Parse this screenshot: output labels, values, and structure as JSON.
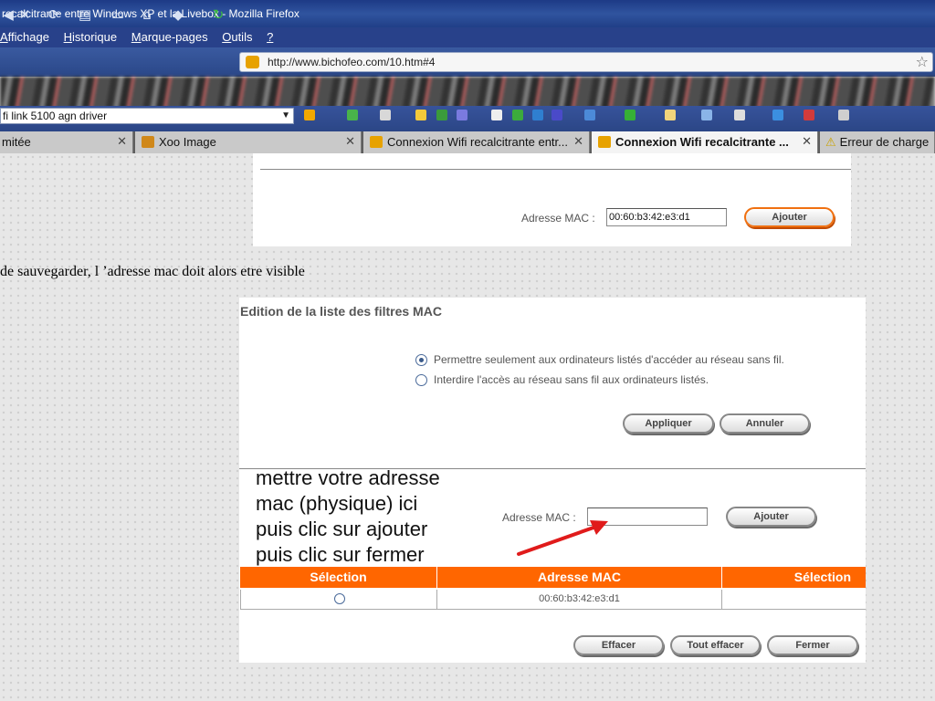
{
  "window": {
    "title": "recalcitrante entre Windows XP et la Livebox - Mozilla Firefox"
  },
  "menu": {
    "items": [
      {
        "label": "Affichage",
        "accel": "A"
      },
      {
        "label": "Historique",
        "accel": "H"
      },
      {
        "label": "Marque-pages",
        "accel": "M"
      },
      {
        "label": "Outils",
        "accel": "O"
      },
      {
        "label": "?",
        "accel": "?"
      }
    ]
  },
  "nav": {
    "url": "http://www.bichofeo.com/10.htm#4",
    "icons": [
      "back-icon",
      "stop-icon",
      "reload-icon",
      "clipboard-icon",
      "page-icon",
      "home-icon",
      "gem-icon",
      "refresh-icon",
      "bookmark-star-icon"
    ]
  },
  "search": {
    "value": "fi link 5100 agn driver"
  },
  "tabs": [
    {
      "label": "mitée",
      "active": false,
      "close": "✕",
      "favicon_color": ""
    },
    {
      "label": "Xoo Image",
      "active": false,
      "close": "✕",
      "favicon_color": "#d0881a"
    },
    {
      "label": "Connexion Wifi recalcitrante entr...",
      "active": false,
      "close": "✕",
      "favicon_color": "#e7a200"
    },
    {
      "label": "Connexion Wifi recalcitrante ...",
      "active": true,
      "close": "✕",
      "favicon_color": "#e7a200"
    },
    {
      "label": "Erreur de charge",
      "active": false,
      "close": "",
      "favicon_color": ""
    }
  ],
  "top_panel": {
    "mac_label": "Adresse MAC :",
    "mac_value": "00:60:b3:42:e3:d1",
    "add_button": "Ajouter"
  },
  "note": "de sauvegarder, l ’adresse mac doit alors etre visible",
  "filter_panel": {
    "title": "Edition de la liste des filtres MAC",
    "options": [
      {
        "label": "Permettre seulement aux ordinateurs listés d'accéder au réseau sans fil.",
        "checked": true
      },
      {
        "label": "Interdire l'accès au réseau sans fil aux ordinateurs listés.",
        "checked": false
      }
    ],
    "apply_button": "Appliquer",
    "cancel_button": "Annuler",
    "mac_label": "Adresse MAC :",
    "mac_value": "",
    "add_button": "Ajouter",
    "table": {
      "headers": [
        "Sélection",
        "Adresse MAC",
        "Sélection"
      ],
      "rows": [
        {
          "mac": "00:60:b3:42:e3:d1"
        }
      ]
    },
    "erase_button": "Effacer",
    "erase_all_button": "Tout effacer",
    "close_button": "Fermer"
  },
  "annotation": {
    "lines": [
      "mettre votre adresse",
      "mac (physique) ici",
      "puis clic sur ajouter",
      "puis clic sur fermer"
    ],
    "arrow_color": "#e01b1b"
  },
  "colors": {
    "accent_orange": "#ff6600",
    "titlebar": "#1d3a86"
  }
}
